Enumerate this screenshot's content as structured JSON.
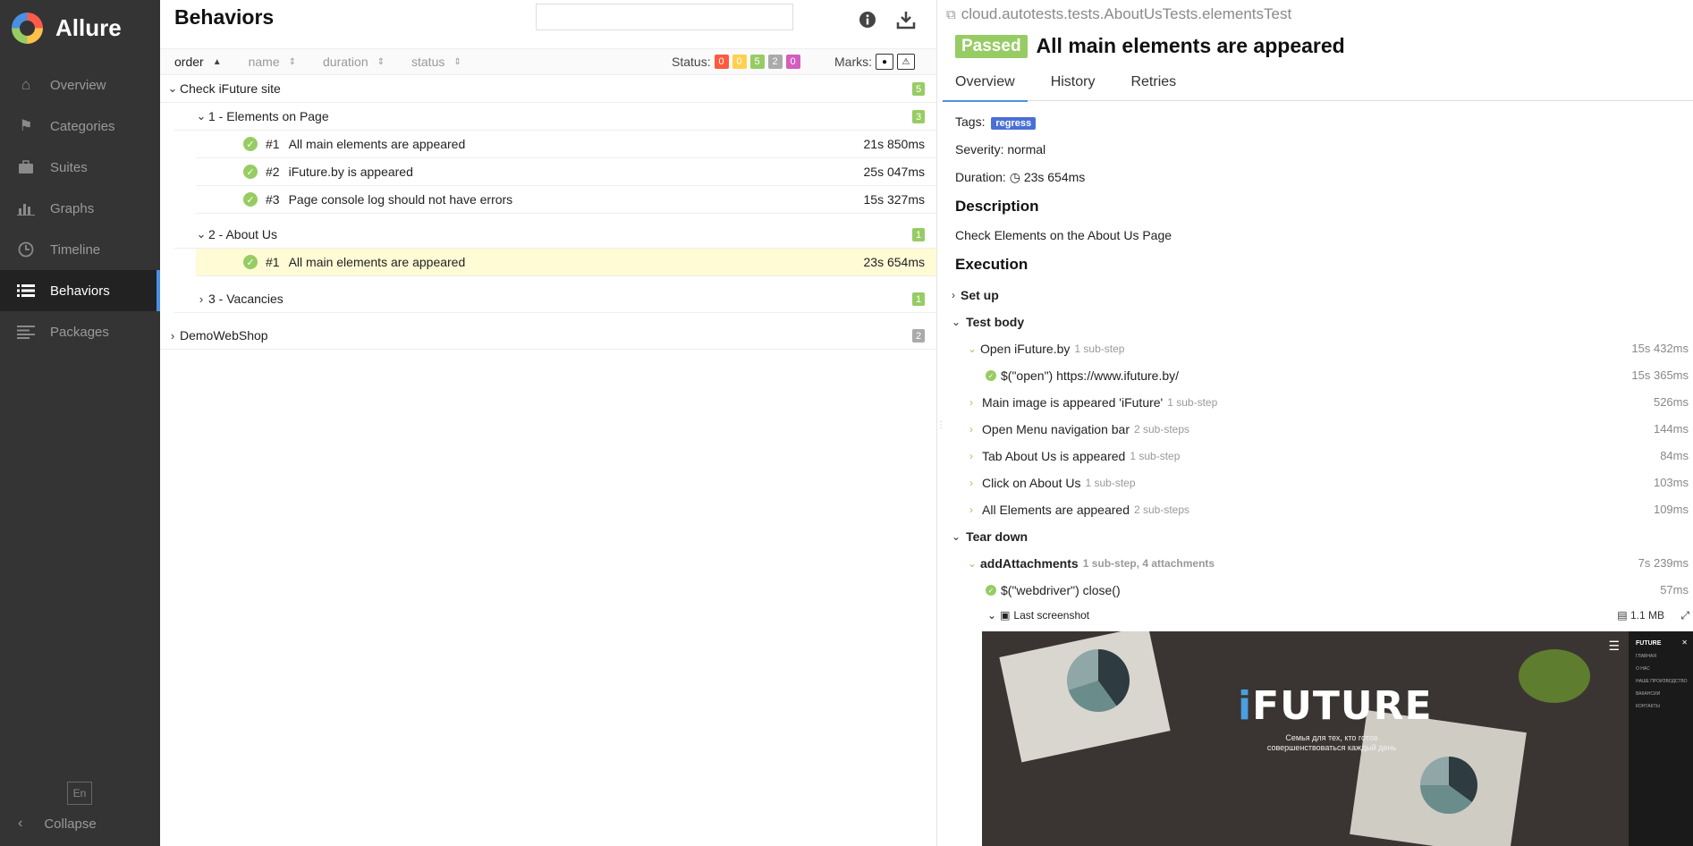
{
  "app": {
    "name": "Allure"
  },
  "sidebar": {
    "items": [
      {
        "label": "Overview",
        "icon": "home-icon"
      },
      {
        "label": "Categories",
        "icon": "flag-icon"
      },
      {
        "label": "Suites",
        "icon": "briefcase-icon"
      },
      {
        "label": "Graphs",
        "icon": "bar-chart-icon"
      },
      {
        "label": "Timeline",
        "icon": "clock-icon"
      },
      {
        "label": "Behaviors",
        "icon": "list-icon",
        "active": true
      },
      {
        "label": "Packages",
        "icon": "align-left-icon"
      }
    ],
    "language": "En",
    "collapse_label": "Collapse"
  },
  "tree_panel": {
    "title": "Behaviors",
    "search": {
      "value": "",
      "placeholder": ""
    },
    "sort": {
      "order": "order",
      "name": "name",
      "duration": "duration",
      "status": "status"
    },
    "status_label": "Status:",
    "status_counts": [
      {
        "value": "0",
        "color": "#fd5a3e"
      },
      {
        "value": "0",
        "color": "#ffd050"
      },
      {
        "value": "5",
        "color": "#97cc64"
      },
      {
        "value": "2",
        "color": "#aaaaaa"
      },
      {
        "value": "0",
        "color": "#d35ebe"
      }
    ],
    "marks_label": "Marks:",
    "groups": {
      "g1": {
        "label": "Check iFuture site",
        "count": "5"
      },
      "g1a": {
        "label": "1 - Elements on Page",
        "count": "3"
      },
      "g1a_items": [
        {
          "num": "#1",
          "name": "All main elements are appeared",
          "duration": "21s 850ms"
        },
        {
          "num": "#2",
          "name": "iFuture.by is appeared",
          "duration": "25s 047ms"
        },
        {
          "num": "#3",
          "name": "Page console log should not have errors",
          "duration": "15s 327ms"
        }
      ],
      "g1b": {
        "label": "2 - About Us",
        "count": "1"
      },
      "g1b_items": [
        {
          "num": "#1",
          "name": "All main elements are appeared",
          "duration": "23s 654ms"
        }
      ],
      "g1c": {
        "label": "3 - Vacancies",
        "count": "1"
      },
      "g2": {
        "label": "DemoWebShop",
        "count": "2"
      }
    }
  },
  "test": {
    "full_name": "cloud.autotests.tests.AboutUsTests.elementsTest",
    "status": "Passed",
    "name": "All main elements are appeared",
    "tabs": [
      "Overview",
      "History",
      "Retries"
    ],
    "tags_label": "Tags:",
    "tag": "regress",
    "severity": "Severity: normal",
    "duration_label": "Duration:",
    "duration": "23s 654ms",
    "description_title": "Description",
    "description": "Check Elements on the About Us Page",
    "execution_title": "Execution",
    "setup": "Set up",
    "test_body": "Test body",
    "steps": [
      {
        "name": "Open iFuture.by",
        "sub": "1 sub-step",
        "duration": "15s 432ms"
      },
      {
        "name": "$(\"open\") https://www.ifuture.by/",
        "sub": "",
        "duration": "15s 365ms"
      },
      {
        "name": "Main image is appeared 'iFuture'",
        "sub": "1 sub-step",
        "duration": "526ms"
      },
      {
        "name": "Open Menu navigation bar",
        "sub": "2 sub-steps",
        "duration": "144ms"
      },
      {
        "name": "Tab About Us is appeared",
        "sub": "1 sub-step",
        "duration": "84ms"
      },
      {
        "name": "Click on About Us",
        "sub": "1 sub-step",
        "duration": "103ms"
      },
      {
        "name": "All Elements are appeared",
        "sub": "2 sub-steps",
        "duration": "109ms"
      }
    ],
    "tear_down": "Tear down",
    "teardown_step": {
      "name": "addAttachments",
      "sub": "1 sub-step, 4 attachments",
      "duration": "7s 239ms"
    },
    "teardown_sub": {
      "name": "$(\"webdriver\") close()",
      "duration": "57ms"
    },
    "attachment": {
      "name": "Last screenshot",
      "size": "1.1 MB"
    },
    "screenshot": {
      "brand": "FUTURE",
      "tagline": "Семья для тех, кто готов совершенствоваться каждый день",
      "menu_items": [
        "ГЛАВНАЯ",
        "О НАС",
        "НАШЕ ПРОИЗВОДСТВО",
        "ВАКАНСИИ",
        "КОНТАКТЫ"
      ],
      "side_title": "FUTURE"
    }
  }
}
